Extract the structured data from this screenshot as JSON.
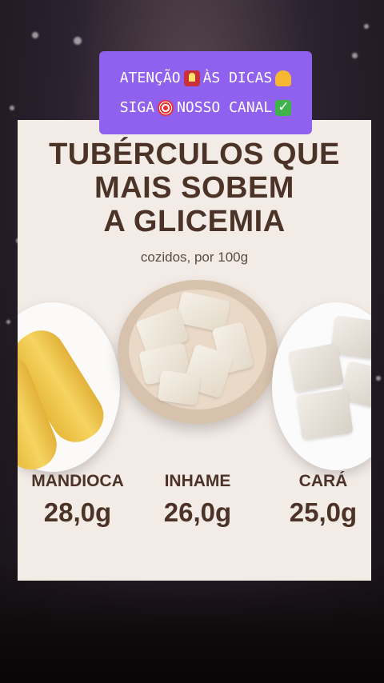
{
  "banner": {
    "line1": "ATENÇÃO",
    "line1b": "ÀS DICAS",
    "line2": "SIGA",
    "line2b": "NOSSO CANAL",
    "icons": [
      "siren-icon",
      "thumbs-up-icon",
      "target-icon",
      "check-icon"
    ]
  },
  "card": {
    "title_line1": "TUBÉRCULOS QUE",
    "title_line2": "MAIS SOBEM",
    "title_line3": "A GLICEMIA",
    "subtitle": "cozidos, por 100g",
    "items": [
      {
        "name": "MANDIOCA",
        "value": "28,0g"
      },
      {
        "name": "INHAME",
        "value": "26,0g"
      },
      {
        "name": "CARÁ",
        "value": "25,0g"
      }
    ]
  },
  "colors": {
    "banner": "#8f61ee",
    "card": "#f3ebe6",
    "text": "#4b3328"
  }
}
